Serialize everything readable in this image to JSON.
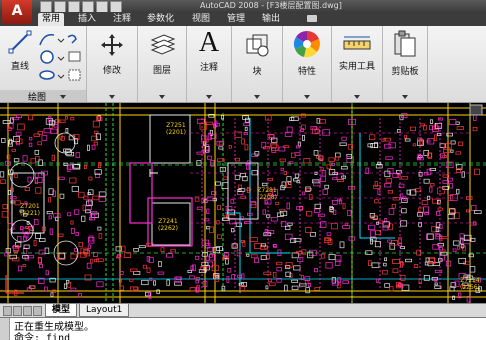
{
  "title_bar": {
    "title": "AutoCAD 2008 - [F3楼层配置图.dwg]",
    "app_button_label": "A"
  },
  "ribbon_tabs": [
    "常用",
    "插入",
    "注释",
    "参数化",
    "视图",
    "管理",
    "输出"
  ],
  "ribbon": {
    "draw": {
      "line_label": "直线",
      "panel_label": "绘图"
    },
    "modify": {
      "label": "修改"
    },
    "layers": {
      "label": "图层"
    },
    "annotation": {
      "label": "注释",
      "icon_letter": "A"
    },
    "block": {
      "label": "块"
    },
    "properties": {
      "label": "特性"
    },
    "utilities": {
      "label": "实用工具"
    },
    "clipboard": {
      "label": "剪贴板"
    }
  },
  "drawing": {
    "room_labels": [
      {
        "name": "Z7251",
        "sub": "(2201)"
      },
      {
        "name": "Z7201",
        "sub": "(2221)"
      },
      {
        "name": "Z7281",
        "sub": "(2208)"
      },
      {
        "name": "Z7241",
        "sub": "(2262)"
      },
      {
        "name": "Z7254",
        "sub": "(2256)"
      }
    ]
  },
  "layout_tabs": [
    "模型",
    "Layout1"
  ],
  "command_line": {
    "line1": "正在重生成模型。",
    "line2": "命令: find"
  },
  "colors": {
    "ribbon_bg": "#e6e6e6",
    "drawing_bg": "#000000",
    "accent_red": "#c0281a"
  }
}
